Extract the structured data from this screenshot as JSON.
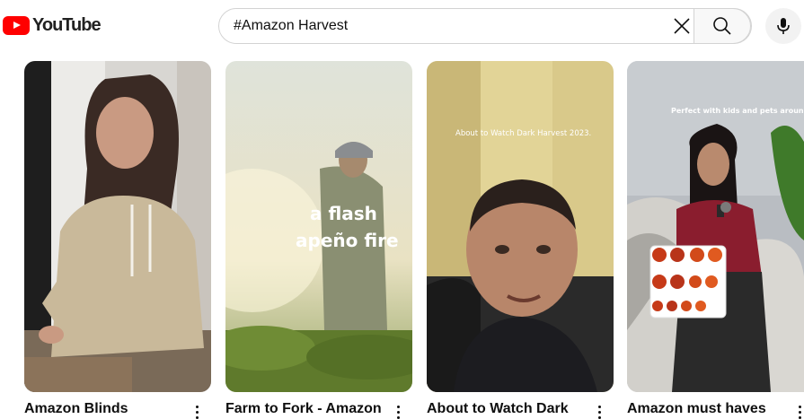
{
  "header": {
    "logo_text": "YouTube",
    "search_value": "#Amazon Harvest",
    "brand_color": "#ff0000"
  },
  "shorts": [
    {
      "title": "Amazon Blinds",
      "overlay_lines": []
    },
    {
      "title": "Farm to Fork - Amazon",
      "overlay_lines": [
        "a flash",
        "apeño fire"
      ]
    },
    {
      "title": "About to Watch Dark",
      "overlay_lines": [
        "About to Watch Dark Harvest 2023."
      ]
    },
    {
      "title": "Amazon must haves",
      "overlay_lines": [
        "Perfect with kids and pets around"
      ]
    }
  ]
}
